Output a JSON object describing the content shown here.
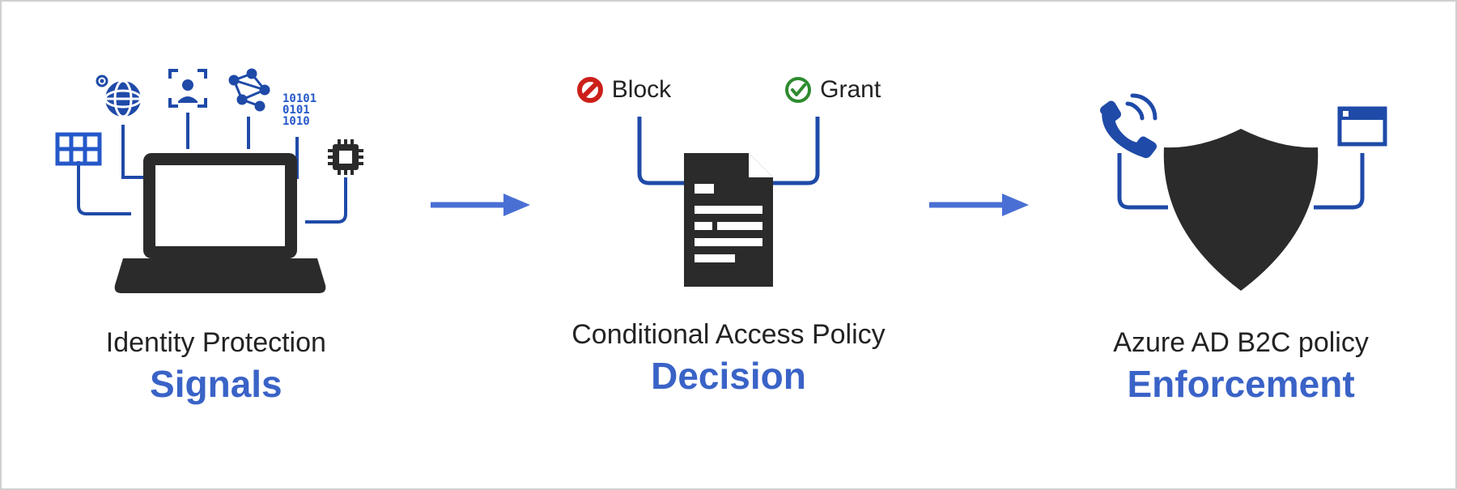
{
  "stages": [
    {
      "title": "Identity Protection",
      "emphasis": "Signals"
    },
    {
      "title": "Conditional Access Policy",
      "emphasis": "Decision"
    },
    {
      "title": "Azure AD B2C policy",
      "emphasis": "Enforcement"
    }
  ],
  "decision": {
    "block_label": "Block",
    "grant_label": "Grant"
  },
  "colors": {
    "accent_blue": "#3a63c7",
    "line_blue": "#1f4aa8",
    "dark": "#2b2b2b",
    "grant_green": "#2e8b2e",
    "block_red": "#cc1f1a"
  }
}
